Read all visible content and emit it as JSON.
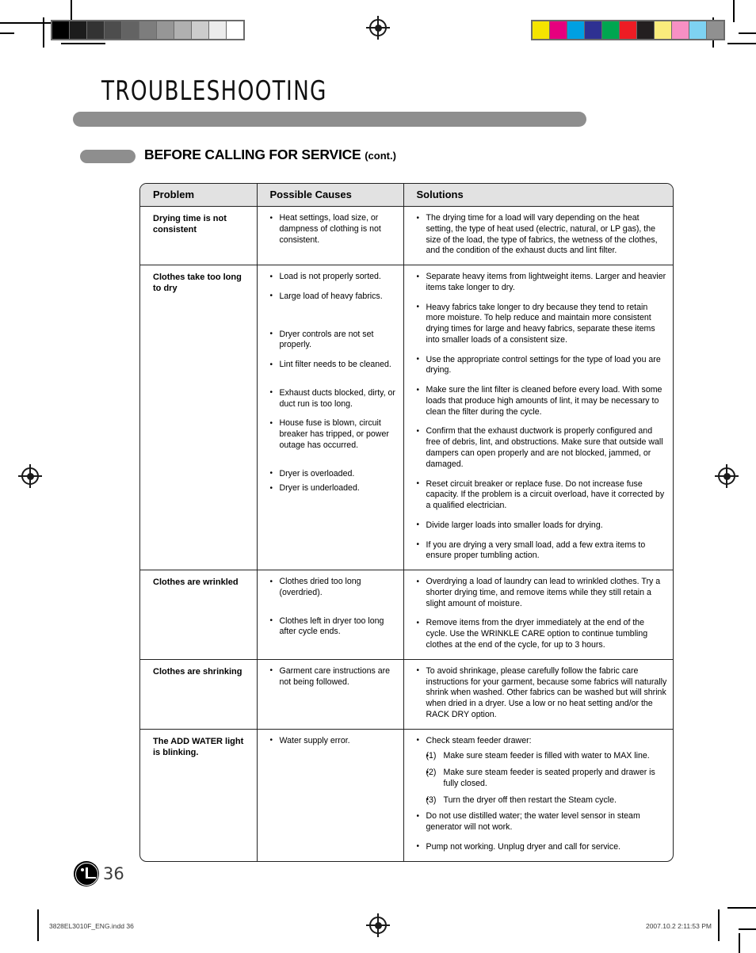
{
  "page": {
    "chapter_title": "TROUBLESHOOTING",
    "section_title": "BEFORE CALLING FOR SERVICE",
    "section_title_suffix": "(cont.)",
    "page_number": "36",
    "accent_gray": "#8e8e8e",
    "header_fill": "#e2e2e2",
    "border_color": "#222222"
  },
  "table": {
    "headers": [
      "Problem",
      "Possible Causes",
      "Solutions"
    ],
    "rows": [
      {
        "problem": "Drying time is not consistent",
        "causes": [
          "Heat settings, load size, or dampness of clothing is not consistent."
        ],
        "solutions": [
          "The drying time for a load will vary depending on the heat setting, the type of heat used (electric, natural, or LP gas), the size of the load, the type of fabrics, the wetness of the clothes, and the condition of the exhaust ducts and lint filter."
        ]
      },
      {
        "problem": "Clothes take too long to dry",
        "causes": [
          "Load is not properly sorted.",
          "Large load of heavy fabrics.",
          "Dryer controls are not set properly.",
          "Lint filter needs to be cleaned.",
          "Exhaust ducts blocked, dirty, or duct run is too long.",
          "House fuse is blown, circuit breaker has tripped, or power outage has occurred.",
          "Dryer is overloaded.",
          "Dryer is underloaded."
        ],
        "solutions": [
          "Separate heavy items from lightweight items. Larger and heavier items take longer to dry.",
          "Heavy fabrics take longer to dry because they tend to retain more moisture. To help reduce and maintain more consistent drying times for large and heavy fabrics, separate these items into smaller loads of a consistent size.",
          "Use the appropriate control settings for the type of load you are drying.",
          "Make sure the lint filter is cleaned before every load. With some loads that produce high amounts of lint, it may be necessary to clean the filter during the cycle.",
          "Confirm that the exhaust ductwork is properly configured and free of debris, lint, and obstructions. Make sure that outside wall dampers can open properly and are not blocked, jammed, or damaged.",
          "Reset circuit breaker or replace fuse. Do not increase fuse capacity. If the problem is a circuit overload, have it corrected by a qualified electrician.",
          "Divide larger loads into smaller loads for drying.",
          "If you are drying a very small load, add a few extra items to ensure proper tumbling action."
        ]
      },
      {
        "problem": "Clothes are wrinkled",
        "causes": [
          "Clothes dried too long (overdried).",
          "Clothes left in dryer too long after cycle ends."
        ],
        "solutions": [
          "Overdrying a load of laundry can lead to wrinkled clothes. Try a shorter drying time, and remove items while they still retain a slight amount of moisture.",
          "Remove items from the dryer immediately at the end of the cycle. Use the WRINKLE CARE option to continue tumbling clothes at the end of the cycle, for up to 3 hours."
        ]
      },
      {
        "problem": "Clothes are shrinking",
        "causes": [
          "Garment care instructions are not being followed."
        ],
        "solutions": [
          "To avoid shrinkage, please carefully follow the fabric care instructions for your garment, because some fabrics will naturally shrink when washed. Other fabrics can be washed but will shrink when dried in a dryer. Use a low or no heat setting and/or the RACK DRY option."
        ]
      },
      {
        "problem": "The ADD WATER light is blinking.",
        "causes": [
          "Water supply error."
        ],
        "solutions": [
          "Check steam feeder drawer:",
          "Do not use distilled water; the water level sensor in steam generator will not work.",
          "Pump not working. Unplug dryer and call for service."
        ],
        "sub_steps": [
          {
            "num": "(1)",
            "text": "Make sure steam feeder is filled with water to MAX line."
          },
          {
            "num": "(2)",
            "text": "Make sure steam feeder is seated properly and drawer is fully closed."
          },
          {
            "num": "(3)",
            "text": "Turn the dryer off then restart the Steam cycle."
          }
        ]
      }
    ]
  },
  "imprint": {
    "left": "3828EL3010F_ENG.indd   36",
    "right": "2007.10.2   2:11:53 PM"
  },
  "print_marks": {
    "grayscale_patches": [
      "#000000",
      "#1c1c1c",
      "#333333",
      "#4d4d4d",
      "#636363",
      "#7d7d7d",
      "#969696",
      "#b0b0b0",
      "#cccccc",
      "#ececec",
      "#ffffff"
    ],
    "color_patches": [
      "#f5e400",
      "#e6007e",
      "#00a0e2",
      "#2e3192",
      "#00a650",
      "#ed1c24",
      "#231f20",
      "#faec7c",
      "#f790c4",
      "#7ed2f2",
      "#909090"
    ]
  }
}
